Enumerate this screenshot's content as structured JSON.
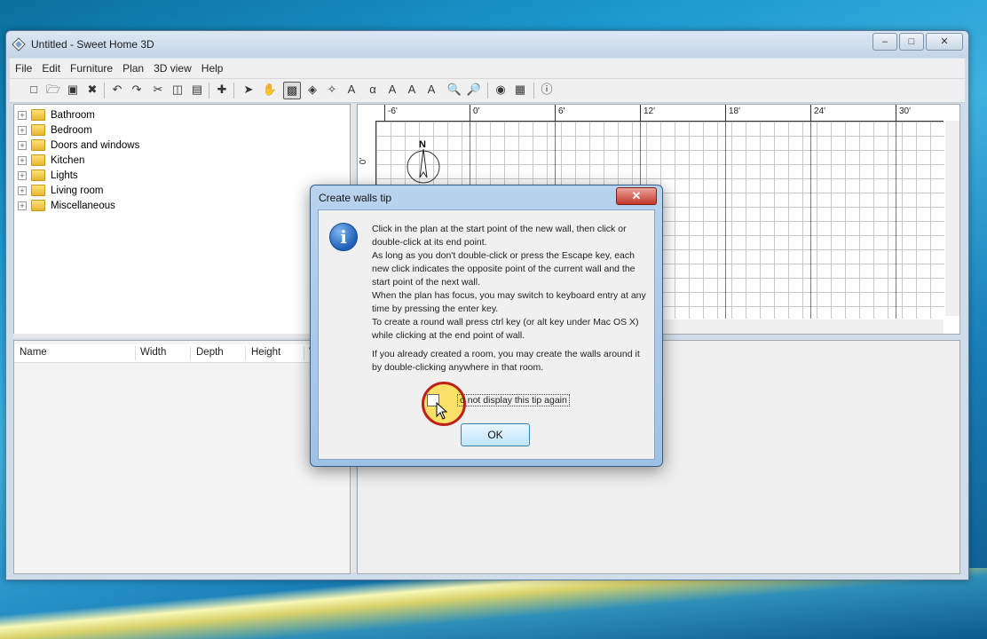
{
  "window": {
    "title": "Untitled - Sweet Home 3D",
    "controls": [
      "‒",
      "□",
      "✕"
    ]
  },
  "menu": [
    "File",
    "Edit",
    "Furniture",
    "Plan",
    "3D view",
    "Help"
  ],
  "toolbar": {
    "icons": [
      "new-icon",
      "open-icon",
      "save-icon",
      "cut-preferences-icon",
      "undo-icon",
      "redo-icon",
      "cut-icon",
      "copy-icon",
      "paste-icon",
      "add-furniture-icon",
      "select-icon",
      "pan-icon",
      "create-walls-icon",
      "create-rooms-icon",
      "create-dimensions-icon",
      "add-text-icon",
      "text-style-icon",
      "text-increase-icon",
      "bold-icon",
      "italic-icon",
      "zoom-in-icon",
      "zoom-out-icon",
      "photo-icon",
      "video-icon",
      "help-icon"
    ]
  },
  "catalog": {
    "items": [
      {
        "expand": "+",
        "label": "Bathroom"
      },
      {
        "expand": "+",
        "label": "Bedroom"
      },
      {
        "expand": "+",
        "label": "Doors and windows"
      },
      {
        "expand": "+",
        "label": "Kitchen"
      },
      {
        "expand": "+",
        "label": "Lights"
      },
      {
        "expand": "+",
        "label": "Living room"
      },
      {
        "expand": "+",
        "label": "Miscellaneous"
      }
    ]
  },
  "furniture_table": {
    "columns": [
      "Name",
      "Width",
      "Depth",
      "Height",
      "V"
    ]
  },
  "plan": {
    "ruler_top": [
      "-6'",
      "0'",
      "6'",
      "12'",
      "18'",
      "24'",
      "30'"
    ],
    "ruler_left": [
      "0'"
    ],
    "compass_label": "N"
  },
  "dialog": {
    "title": "Create walls tip",
    "close": "✕",
    "info_glyph": "i",
    "paragraphs": [
      "Click in the plan at the start point of the new wall, then click or double-click at its end point.",
      "As long as you don't double-click or press the Escape key, each new click indicates the opposite point of the current wall and the start point of the next wall.",
      "When the plan has focus, you may switch to keyboard entry at any time by pressing the enter key.",
      "To create a round wall press ctrl key (or alt key under Mac OS X) while clicking at the end point of wall.",
      "If you already created a room, you may create the walls around it by double-clicking anywhere in that room."
    ],
    "checkbox_label": "o not display this tip again",
    "checkbox_checked": false,
    "ok_label": "OK"
  }
}
